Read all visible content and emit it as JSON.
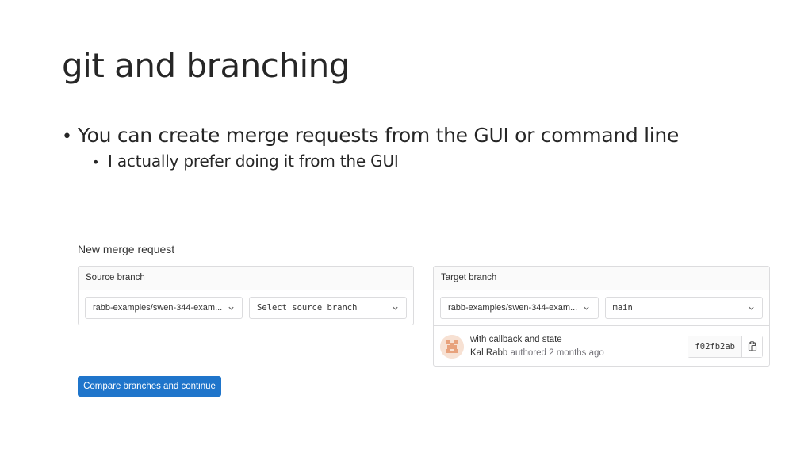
{
  "slide": {
    "title": "git and branching",
    "bullet_1": "You can create merge requests from the GUI or command line",
    "bullet_1_sub": "I actually prefer doing it from the GUI"
  },
  "merge_request": {
    "heading": "New merge request",
    "source": {
      "header": "Source branch",
      "project_value": "rabb-examples/swen-344-exam...",
      "branch_placeholder": "Select source branch"
    },
    "target": {
      "header": "Target branch",
      "project_value": "rabb-examples/swen-344-exam...",
      "branch_value": "main"
    },
    "commit": {
      "title": "with callback and state",
      "author": "Kal Rabb",
      "meta": "authored 2 months ago",
      "sha": "f02fb2ab",
      "copy_icon": "clipboard-icon"
    },
    "compare_button": "Compare branches and continue"
  },
  "colors": {
    "primary": "#1f75cb",
    "border": "#dcdcde",
    "header_bg": "#fafafa",
    "avatar": "#e8a27c"
  }
}
